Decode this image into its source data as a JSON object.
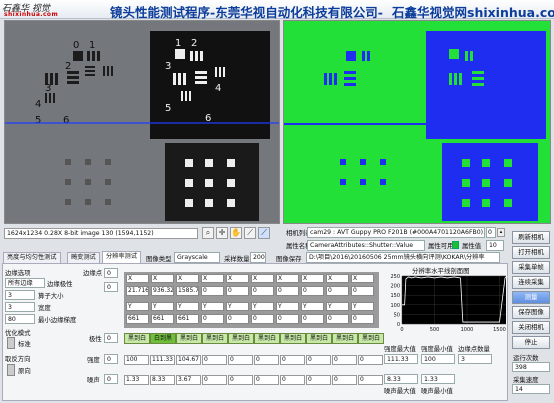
{
  "header": {
    "logo_line1": "石鑫华 视觉",
    "logo_line2": "shixinhua.com",
    "title": "镜头性能测试程序-东莞华视自动化科技有限公司-",
    "title_suffix": "石鑫华视觉网shixinhua.com"
  },
  "left_view": {
    "status": "1624x1234 0.28X 8-bit image 130     (1594,1152)",
    "target_numbers": [
      "0",
      "1",
      "2",
      "3",
      "4",
      "5",
      "6",
      "1",
      "2",
      "3",
      "4",
      "5",
      "6"
    ]
  },
  "right_panel": {
    "camera_list_label": "相机列表",
    "camera_value": "cam29 : AVT Guppy PRO F201B (#000A4701120A6FB0).icd",
    "camera_index": "0",
    "attr_name_label": "属性名称",
    "attr_name_value": "CameraAttributes::Shutter::Value",
    "attr_enable_label": "属性可用",
    "attr_value_label": "属性值",
    "attr_value": "10",
    "image_type_label": "图像类型",
    "image_type_value": "Grayscale",
    "sample_count_label": "采样数量",
    "sample_count_value": "200",
    "image_save_label": "图像保存",
    "image_save_path": "D:\\项目\\2016\\20160506 25mm镜头横向评测\\KOKAR\\分辨率"
  },
  "right_buttons": [
    "刷新相机",
    "打开相机",
    "采集单帧",
    "连续采集",
    "测量",
    "保存图像",
    "关闭相机",
    "停止"
  ],
  "run_count_label": "运行次数",
  "run_count_value": "398",
  "speed_label": "采集速度",
  "speed_value": "14",
  "tabs": [
    "亮度与均匀性测试",
    "畸变测试",
    "分辨率测试"
  ],
  "selected_tab": "分辨率测试",
  "resolution": {
    "edge_options_label": "边缘选项",
    "edge_polarity_value": "所有边缘",
    "edge_polarity_label": "边缘极性",
    "kernel_size_value": "3",
    "kernel_size_label": "算子大小",
    "width_value": "3",
    "width_label": "宽度",
    "min_strength_value": "80",
    "min_strength_label": "最小边缘梯度",
    "optimize_label": "优化模式",
    "optimize_value": "标准",
    "direction_label": "取反方向",
    "direction_value": "原向",
    "edge_points_label": "边缘点",
    "edge_points_index": "0",
    "table_index": "0",
    "col_headers": [
      "X",
      "X",
      "X",
      "X",
      "X",
      "X",
      "X",
      "X",
      "X",
      "X"
    ],
    "row_x_values": [
      "21.716",
      "936.32",
      "1585.7",
      "0",
      "0",
      "0",
      "0",
      "0",
      "0",
      "0"
    ],
    "row_y_headers": [
      "Y",
      "Y",
      "Y",
      "Y",
      "Y",
      "Y",
      "Y",
      "Y",
      "Y",
      "Y"
    ],
    "row_y_values": [
      "661",
      "661",
      "661",
      "0",
      "0",
      "0",
      "0",
      "0",
      "0",
      "0"
    ],
    "polarity_label": "极性",
    "polarity_index": "0",
    "polarity_values": [
      "黑到白",
      "白到黑",
      "黑到白",
      "黑到白",
      "黑到白",
      "黑到白",
      "黑到白",
      "黑到白",
      "黑到白",
      "黑到白"
    ],
    "strength_label": "强度",
    "strength_index": "0",
    "strength_values": [
      "100",
      "111.33",
      "104.67",
      "0",
      "0",
      "0",
      "0",
      "0",
      "0",
      "0"
    ],
    "noise_label": "噪声",
    "noise_index": "0",
    "noise_values": [
      "1.33",
      "8.33",
      "3.67",
      "0",
      "0",
      "0",
      "0",
      "0",
      "0",
      "0"
    ],
    "chart_title": "分辨率水平线剖面图",
    "strength_max_label": "强度最大值",
    "strength_max_value": "111.33",
    "strength_min_label": "强度最小值",
    "strength_min_value": "100",
    "edge_count_label": "边缘点数量",
    "edge_count_value": "3",
    "noise_max_label": "噪声最大值",
    "noise_max_value": "8.33",
    "noise_min_label": "噪声最小值",
    "noise_min_value": "1.33"
  },
  "chart_data": {
    "type": "line",
    "title": "分辨率水平线剖面图",
    "x": [
      0,
      20,
      40,
      60,
      100,
      150,
      200,
      300,
      400,
      500,
      600,
      700,
      800,
      900,
      936,
      1000,
      1100,
      1200,
      1300,
      1400,
      1500,
      1585,
      1600,
      1624
    ],
    "y": [
      100,
      100,
      100,
      235,
      245,
      240,
      245,
      240,
      245,
      240,
      245,
      240,
      245,
      240,
      10,
      10,
      10,
      10,
      10,
      10,
      10,
      240,
      245,
      245
    ],
    "xlim": [
      0,
      1600
    ],
    "ylim": [
      0,
      250
    ],
    "xticks": [
      "0",
      "500",
      "1000",
      "1500"
    ],
    "yticks": [
      "0",
      "50",
      "100",
      "150",
      "200",
      "250"
    ],
    "grid": true,
    "colors": {
      "line": "#ffffff",
      "bg": "#000000"
    }
  }
}
